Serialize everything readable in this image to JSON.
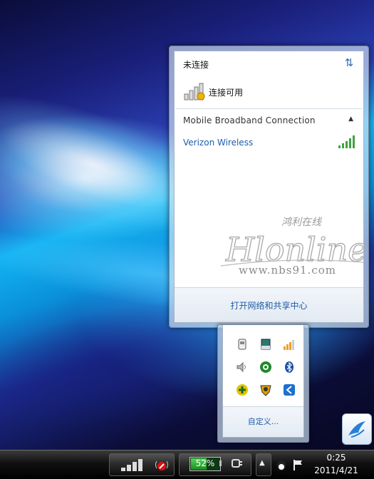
{
  "network_flyout": {
    "status": "未连接",
    "available": "连接可用",
    "section_header": "Mobile Broadband Connection",
    "connection_name": "Verizon Wireless",
    "footer_link": "打开网络和共享中心",
    "watermark_text": "鸿利在线",
    "watermark_logo": "Hlonline",
    "watermark_url": "www.nbs91.com"
  },
  "tray_overflow": {
    "icons": [
      "device-icon",
      "drive-icon",
      "signal-bars-icon",
      "volume-icon",
      "green-ring-icon",
      "bluetooth-icon",
      "green-plus-icon",
      "shield-badge-icon",
      "blue-arrow-icon"
    ],
    "customize_label": "自定义..."
  },
  "taskbar": {
    "battery_percent": "52%",
    "time": "0:25",
    "date": "2011/4/21"
  },
  "colors": {
    "link": "#1d5ea8",
    "signal_green": "#3fa43f",
    "signal_orange": "#f0a020"
  }
}
